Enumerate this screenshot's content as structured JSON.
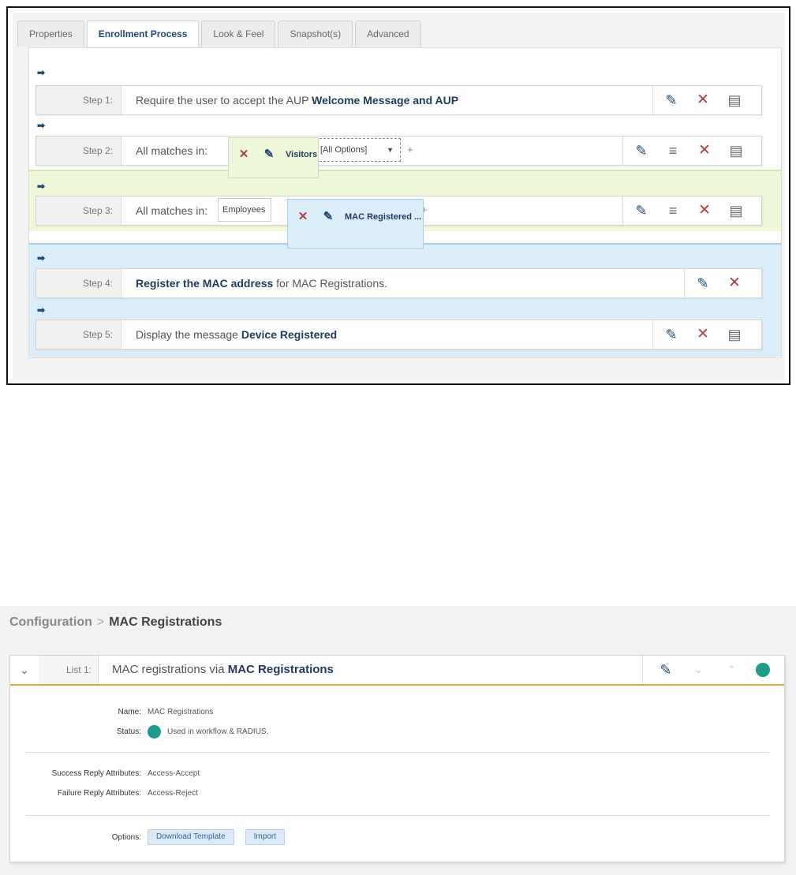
{
  "tabs": [
    {
      "label": "Properties",
      "active": false
    },
    {
      "label": "Enrollment Process",
      "active": true
    },
    {
      "label": "Look & Feel",
      "active": false
    },
    {
      "label": "Snapshot(s)",
      "active": false
    },
    {
      "label": "Advanced",
      "active": false
    }
  ],
  "steps": [
    {
      "label": "Step 1:",
      "text_plain": "Require the user to accept the AUP ",
      "text_bold": "Welcome Message and AUP"
    },
    {
      "label": "Step 2:",
      "text_plain": "All matches in:",
      "chip_visitors": "Visitors",
      "chip_options": "[All Options]",
      "plus": "+"
    },
    {
      "label": "Step 3:",
      "text_plain": "All matches in:",
      "chip_employees": "Employees",
      "chip_mac": "MAC Registered ...",
      "plus": "+"
    },
    {
      "label": "Step 4:",
      "text_bold": "Register the MAC address",
      "text_plain": " for MAC Registrations."
    },
    {
      "label": "Step 5:",
      "text_plain": "Display the message ",
      "text_bold": "Device Registered"
    }
  ],
  "breadcrumb": {
    "root": "Configuration",
    "separator": ">",
    "current": "MAC Registrations"
  },
  "list": {
    "label": "List 1:",
    "text_plain": "MAC registrations via ",
    "text_bold": "MAC Registrations",
    "name_key": "Name:",
    "name_value": "MAC Registrations",
    "status_key": "Status:",
    "status_value": "Used in workflow & RADIUS.",
    "success_key": "Success Reply Attributes:",
    "success_value": "Access-Accept",
    "failure_key": "Failure Reply Attributes:",
    "failure_value": "Access-Reject",
    "options_key": "Options:",
    "buttons": [
      "Download Template",
      "Import"
    ]
  },
  "colors": {
    "accent": "#1f4a75",
    "status": "#1e9b8c",
    "delete": "#b04040",
    "divider": "#e8a93a"
  },
  "icons": {
    "arrow": "arrow-right-icon",
    "edit": "pencil-icon",
    "delete": "close-icon",
    "reorder": "lines-icon",
    "message": "comment-icon"
  }
}
